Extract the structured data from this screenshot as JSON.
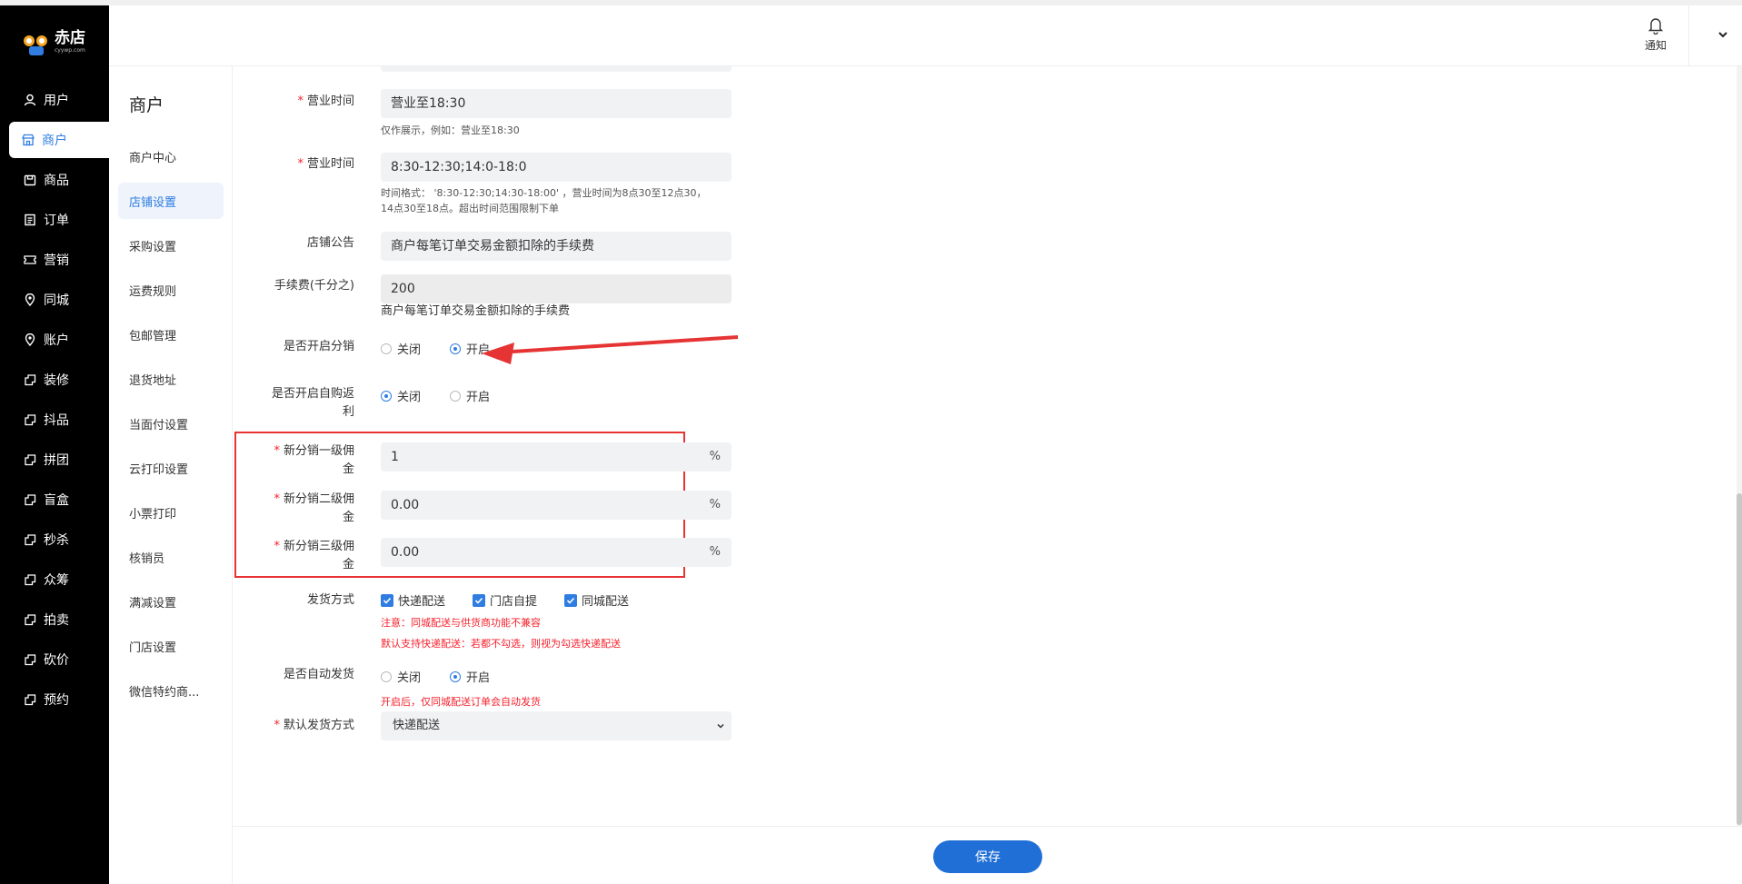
{
  "app": {
    "logo_name": "赤店",
    "logo_sub": "cyywp.com"
  },
  "topbar": {
    "notice_label": "通知"
  },
  "leftnav": {
    "items": [
      {
        "label": "用户",
        "icon": "user-icon"
      },
      {
        "label": "商户",
        "icon": "store-icon"
      },
      {
        "label": "商品",
        "icon": "goods-icon"
      },
      {
        "label": "订单",
        "icon": "order-icon"
      },
      {
        "label": "营销",
        "icon": "ticket-icon"
      },
      {
        "label": "同城",
        "icon": "location-icon"
      },
      {
        "label": "账户",
        "icon": "location-icon"
      },
      {
        "label": "装修",
        "icon": "plugin-icon"
      },
      {
        "label": "抖品",
        "icon": "plugin-icon"
      },
      {
        "label": "拼团",
        "icon": "plugin-icon"
      },
      {
        "label": "盲盒",
        "icon": "plugin-icon"
      },
      {
        "label": "秒杀",
        "icon": "plugin-icon"
      },
      {
        "label": "众筹",
        "icon": "plugin-icon"
      },
      {
        "label": "拍卖",
        "icon": "plugin-icon"
      },
      {
        "label": "砍价",
        "icon": "plugin-icon"
      },
      {
        "label": "预约",
        "icon": "plugin-icon"
      }
    ],
    "active_index": 1
  },
  "subnav": {
    "title": "商户",
    "items": [
      "商户中心",
      "店铺设置",
      "采购设置",
      "运费规则",
      "包邮管理",
      "退货地址",
      "当面付设置",
      "云打印设置",
      "小票打印",
      "核销员",
      "满减设置",
      "门店设置",
      "微信特约商..."
    ],
    "active_index": 1
  },
  "form": {
    "business_hours_1": {
      "label": "营业时间",
      "value": "营业至18:30",
      "hint": "仅作展示，例如：营业至18:30"
    },
    "business_hours_2": {
      "label": "营业时间",
      "value": "8:30-12:30;14:0-18:0",
      "hint_line1": "时间格式：  '8:30-12:30;14:30-18:00'  ，营业时间为8点30至12点30，",
      "hint_line2": "14点30至18点。超出时间范围限制下单"
    },
    "notice": {
      "label": "店铺公告",
      "value": "商户每笔订单交易金额扣除的手续费"
    },
    "fee": {
      "label": "手续费(千分之)",
      "value": "200",
      "hint": "商户每笔订单交易金额扣除的手续费"
    },
    "distribution": {
      "label": "是否开启分销",
      "off": "关闭",
      "on": "开启",
      "selected": "on"
    },
    "self_rebate": {
      "label_line1": "是否开启自购返",
      "label_line2": "利",
      "off": "关闭",
      "on": "开启",
      "selected": "off"
    },
    "commission_1": {
      "label_line1": "新分销一级佣",
      "label_line2": "金",
      "value": "1",
      "suffix": "%"
    },
    "commission_2": {
      "label_line1": "新分销二级佣",
      "label_line2": "金",
      "value": "0.00",
      "suffix": "%"
    },
    "commission_3": {
      "label_line1": "新分销三级佣",
      "label_line2": "金",
      "value": "0.00",
      "suffix": "%"
    },
    "delivery": {
      "label": "发货方式",
      "options": [
        "快递配送",
        "门店自提",
        "同城配送"
      ],
      "warn1": "注意：同城配送与供货商功能不兼容",
      "warn2": "默认支持快递配送：若都不勾选，则视为勾选快递配送"
    },
    "auto_ship": {
      "label": "是否自动发货",
      "off": "关闭",
      "on": "开启",
      "selected": "on",
      "hint": "开启后，仅同城配送订单会自动发货"
    },
    "default_delivery": {
      "label": "默认发货方式",
      "value": "快递配送"
    }
  },
  "footer": {
    "save_label": "保存"
  },
  "colors": {
    "accent": "#2f7de1",
    "nav_bg": "#000000",
    "highlight_red": "#e63333"
  }
}
